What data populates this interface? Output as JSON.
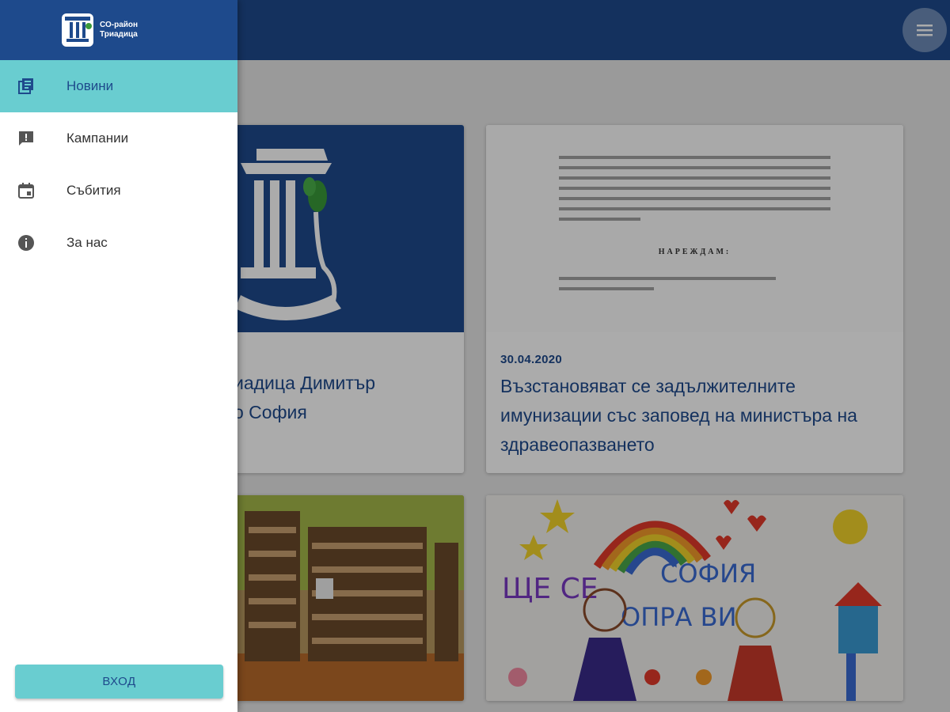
{
  "app": {
    "logo_text_line1": "СО-район",
    "logo_text_line2": "Триадица"
  },
  "drawer": {
    "items": [
      {
        "label": "Новини",
        "icon": "news-icon",
        "active": true
      },
      {
        "label": "Кампании",
        "icon": "campaign-icon",
        "active": false
      },
      {
        "label": "Събития",
        "icon": "calendar-icon",
        "active": false
      },
      {
        "label": "За нас",
        "icon": "info-icon",
        "active": false
      }
    ],
    "login_label": "ВХОД"
  },
  "cards": [
    {
      "title_line1": "иадица Димитър",
      "title_line2": "о София",
      "image": "district-logo-image"
    },
    {
      "date": "30.04.2020",
      "title": "Възстановяват се задължителните имунизации със заповед на министъра на здравеопазването",
      "image": "document-image",
      "doc_heading": "НАРЕЖДАМ:"
    },
    {
      "image": "library-image"
    },
    {
      "image": "childrens-drawing-image",
      "drawing_text_line1": "ЩЕ СЕ",
      "drawing_text_line2": "СОФИЯ",
      "drawing_text_line3": "ОПРА ВИ"
    }
  ],
  "colors": {
    "primary": "#1e4a8c",
    "accent": "#69cdd0"
  }
}
